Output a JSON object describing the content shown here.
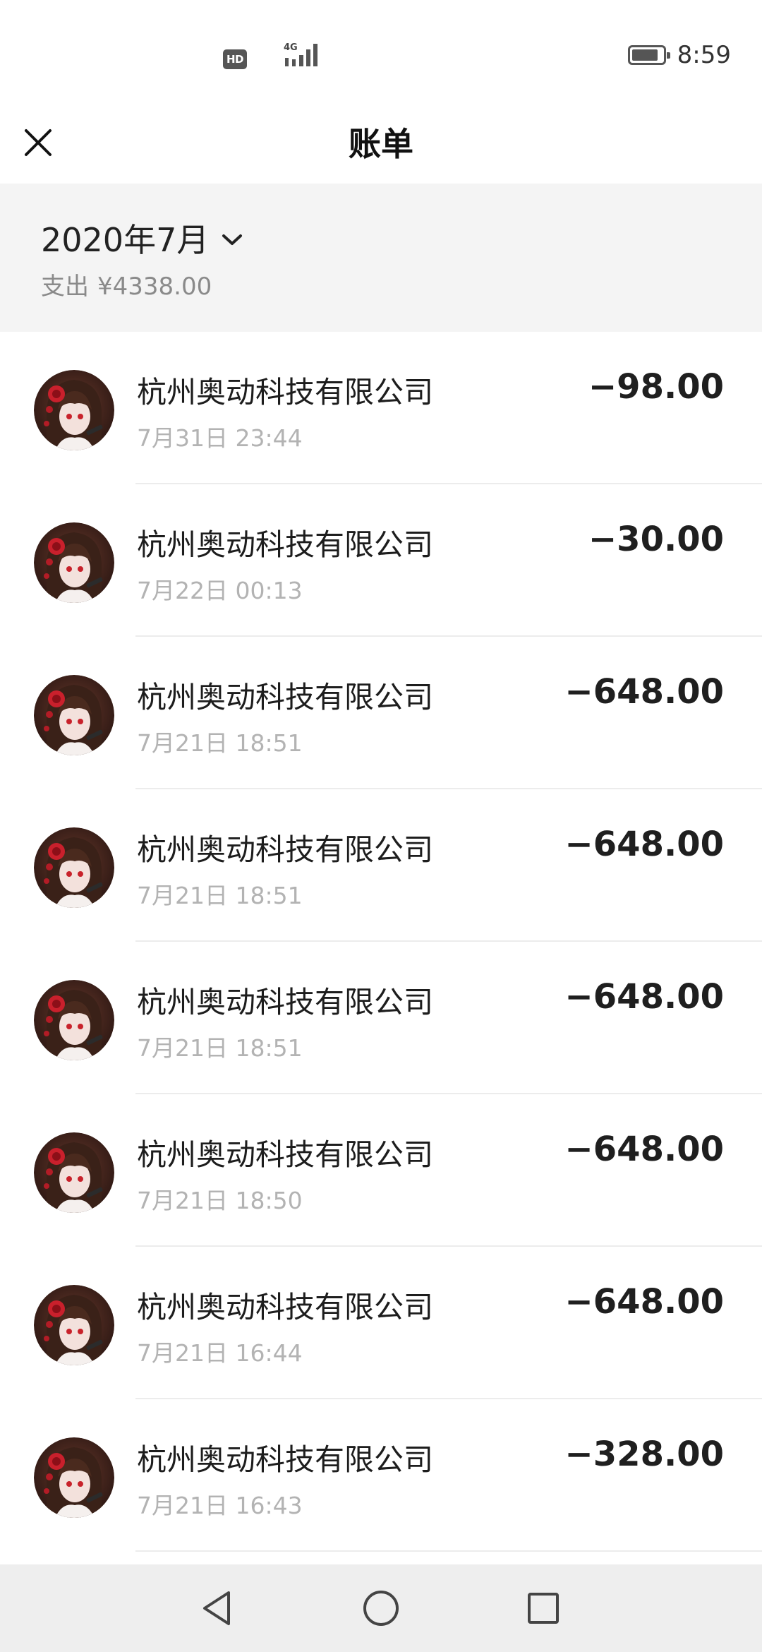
{
  "status_bar": {
    "hd_label": "HD",
    "network": "4G",
    "time": "8:59",
    "battery_level": 0.85
  },
  "header": {
    "title": "账单",
    "close_icon": "close-icon"
  },
  "summary": {
    "month": "2020年7月",
    "expense_label": "支出",
    "expense_amount": "¥4338.00"
  },
  "transactions": [
    {
      "merchant": "杭州奥动科技有限公司",
      "time": "7月31日 23:44",
      "amount": "−98.00"
    },
    {
      "merchant": "杭州奥动科技有限公司",
      "time": "7月22日 00:13",
      "amount": "−30.00"
    },
    {
      "merchant": "杭州奥动科技有限公司",
      "time": "7月21日 18:51",
      "amount": "−648.00"
    },
    {
      "merchant": "杭州奥动科技有限公司",
      "time": "7月21日 18:51",
      "amount": "−648.00"
    },
    {
      "merchant": "杭州奥动科技有限公司",
      "time": "7月21日 18:51",
      "amount": "−648.00"
    },
    {
      "merchant": "杭州奥动科技有限公司",
      "time": "7月21日 18:50",
      "amount": "−648.00"
    },
    {
      "merchant": "杭州奥动科技有限公司",
      "time": "7月21日 16:44",
      "amount": "−648.00"
    },
    {
      "merchant": "杭州奥动科技有限公司",
      "time": "7月21日 16:43",
      "amount": "−328.00"
    }
  ],
  "nav_bar": {
    "icons": [
      "back-triangle-icon",
      "home-circle-icon",
      "recents-square-icon"
    ]
  },
  "colors": {
    "summary_bg": "#f4f4f4",
    "text_primary": "#1d1d1d",
    "text_secondary": "#b3b3b3"
  }
}
